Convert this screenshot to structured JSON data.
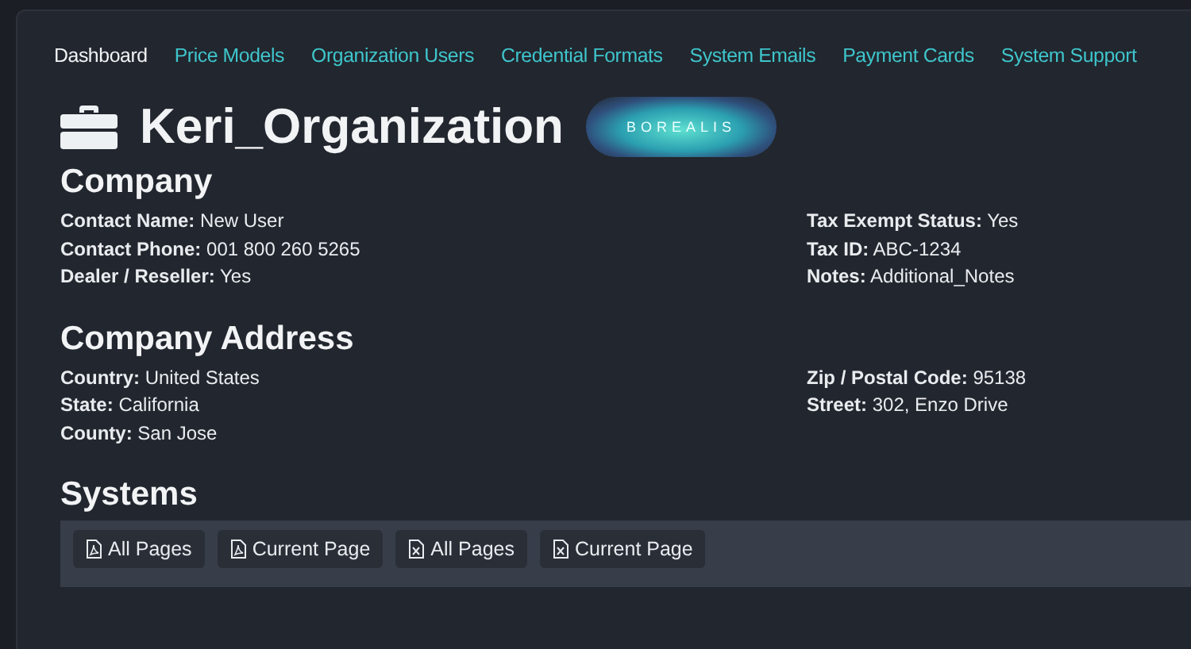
{
  "nav": [
    {
      "label": "Dashboard",
      "selected": true
    },
    {
      "label": "Price Models",
      "selected": false
    },
    {
      "label": "Organization Users",
      "selected": false
    },
    {
      "label": "Credential Formats",
      "selected": false
    },
    {
      "label": "System Emails",
      "selected": false
    },
    {
      "label": "Payment Cards",
      "selected": false
    },
    {
      "label": "System Support",
      "selected": false
    }
  ],
  "title": "Keri_Organization",
  "logo": {
    "text": "BOREALIS"
  },
  "sections": [
    {
      "heading": "Company",
      "left": [
        {
          "label": "Contact Name:",
          "value": "New User"
        },
        {
          "label": "Contact Phone:",
          "value": "001 800 260 5265"
        },
        {
          "label": "Dealer / Reseller:",
          "value": "Yes"
        }
      ],
      "right": [
        {
          "label": "Tax Exempt Status:",
          "value": "Yes"
        },
        {
          "label": "Tax ID:",
          "value": "ABC-1234"
        },
        {
          "label": "Notes:",
          "value": "Additional_Notes"
        }
      ]
    },
    {
      "heading": "Company Address",
      "left": [
        {
          "label": "Country:",
          "value": "United States"
        },
        {
          "label": "State:",
          "value": "California"
        },
        {
          "label": "County:",
          "value": "San Jose"
        }
      ],
      "right": [
        {
          "label": "Zip / Postal Code:",
          "value": "95138"
        },
        {
          "label": "Street:",
          "value": "302, Enzo Drive"
        }
      ]
    }
  ],
  "systems": {
    "heading": "Systems",
    "buttons": [
      {
        "kind": "pdf",
        "label": "All Pages"
      },
      {
        "kind": "pdf",
        "label": "Current Page"
      },
      {
        "kind": "excel",
        "label": "All Pages"
      },
      {
        "kind": "excel",
        "label": "Current Page"
      }
    ]
  }
}
